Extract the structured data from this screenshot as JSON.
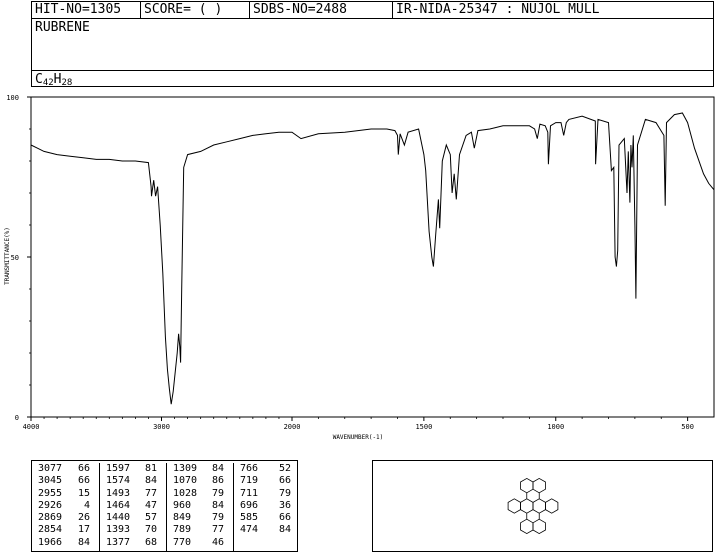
{
  "header": {
    "hit_no": "HIT-NO=1305",
    "score": "SCORE=  (  )",
    "sdbs_no": "SDBS-NO=2488",
    "ir_info": "IR-NIDA-25347 : NUJOL MULL",
    "compound": "RUBRENE",
    "formula_c": "C",
    "formula_c_sub": "42",
    "formula_h": "H",
    "formula_h_sub": "28"
  },
  "chart_data": {
    "type": "line",
    "title": "",
    "xlabel": "WAVENUMBER(-1)",
    "ylabel": "TRANSMITTANCE(%)",
    "xlim": [
      4000,
      400
    ],
    "ylim": [
      0,
      100
    ],
    "x_ticks": [
      "4000",
      "3000",
      "2000",
      "1500",
      "1000",
      "500"
    ],
    "y_ticks": [
      "100",
      "50",
      "0"
    ],
    "grid": false,
    "series": [
      {
        "color": "#000000",
        "x": [
          4000,
          3950,
          3900,
          3800,
          3700,
          3600,
          3500,
          3400,
          3300,
          3200,
          3100,
          3080,
          3077,
          3060,
          3045,
          3030,
          3010,
          2990,
          2970,
          2955,
          2940,
          2926,
          2910,
          2880,
          2869,
          2860,
          2854,
          2845,
          2830,
          2800,
          2700,
          2600,
          2500,
          2400,
          2300,
          2200,
          2100,
          2000,
          1966,
          1900,
          1800,
          1700,
          1640,
          1610,
          1600,
          1597,
          1590,
          1574,
          1560,
          1520,
          1500,
          1493,
          1480,
          1470,
          1464,
          1455,
          1445,
          1440,
          1430,
          1415,
          1400,
          1393,
          1385,
          1377,
          1365,
          1340,
          1320,
          1309,
          1295,
          1250,
          1200,
          1150,
          1100,
          1080,
          1070,
          1060,
          1040,
          1030,
          1028,
          1020,
          1000,
          980,
          970,
          960,
          950,
          900,
          850,
          849,
          840,
          800,
          789,
          780,
          775,
          770,
          765,
          760,
          740,
          730,
          725,
          719,
          715,
          711,
          706,
          700,
          696,
          690,
          660,
          620,
          590,
          585,
          580,
          550,
          520,
          500,
          474,
          440,
          420,
          400
        ],
        "y": [
          85,
          84,
          83,
          82,
          81.5,
          81,
          80.5,
          80.5,
          80,
          80,
          79.5,
          72,
          69,
          74,
          69,
          72,
          60,
          45,
          25,
          15,
          9,
          4,
          8,
          20,
          26,
          22,
          17,
          40,
          78,
          82,
          83,
          85,
          86,
          87,
          88,
          88.5,
          89,
          89,
          87,
          88.5,
          89,
          90,
          90,
          89.5,
          88,
          82,
          88.5,
          85,
          89,
          90,
          82,
          77,
          58,
          50,
          47,
          57,
          68,
          59,
          80,
          85,
          82,
          70,
          76,
          68,
          82,
          88,
          89,
          84,
          89.5,
          90,
          91,
          91,
          91,
          90,
          87,
          91.5,
          91,
          89,
          79,
          91,
          92,
          92,
          88,
          92,
          93,
          94,
          92.5,
          79,
          93,
          92,
          77,
          78,
          50,
          47,
          52,
          85,
          87,
          70,
          83,
          67,
          85,
          78,
          88,
          60,
          37,
          85,
          93,
          92,
          88,
          66,
          92,
          94.5,
          95,
          92,
          84,
          76,
          73,
          71
        ]
      }
    ]
  },
  "peaks": [
    [
      [
        "3077",
        "66"
      ],
      [
        "3045",
        "66"
      ],
      [
        "2955",
        "15"
      ],
      [
        "2926",
        "4"
      ],
      [
        "2869",
        "26"
      ],
      [
        "2854",
        "17"
      ],
      [
        "1966",
        "84"
      ]
    ],
    [
      [
        "1597",
        "81"
      ],
      [
        "1574",
        "84"
      ],
      [
        "1493",
        "77"
      ],
      [
        "1464",
        "47"
      ],
      [
        "1440",
        "57"
      ],
      [
        "1393",
        "70"
      ],
      [
        "1377",
        "68"
      ]
    ],
    [
      [
        "1309",
        "84"
      ],
      [
        "1070",
        "86"
      ],
      [
        "1028",
        "79"
      ],
      [
        "960",
        "84"
      ],
      [
        "849",
        "79"
      ],
      [
        "789",
        "77"
      ],
      [
        "770",
        "46"
      ]
    ],
    [
      [
        "766",
        "52"
      ],
      [
        "719",
        "66"
      ],
      [
        "711",
        "79"
      ],
      [
        "696",
        "36"
      ],
      [
        "585",
        "66"
      ],
      [
        "474",
        "84"
      ]
    ]
  ]
}
